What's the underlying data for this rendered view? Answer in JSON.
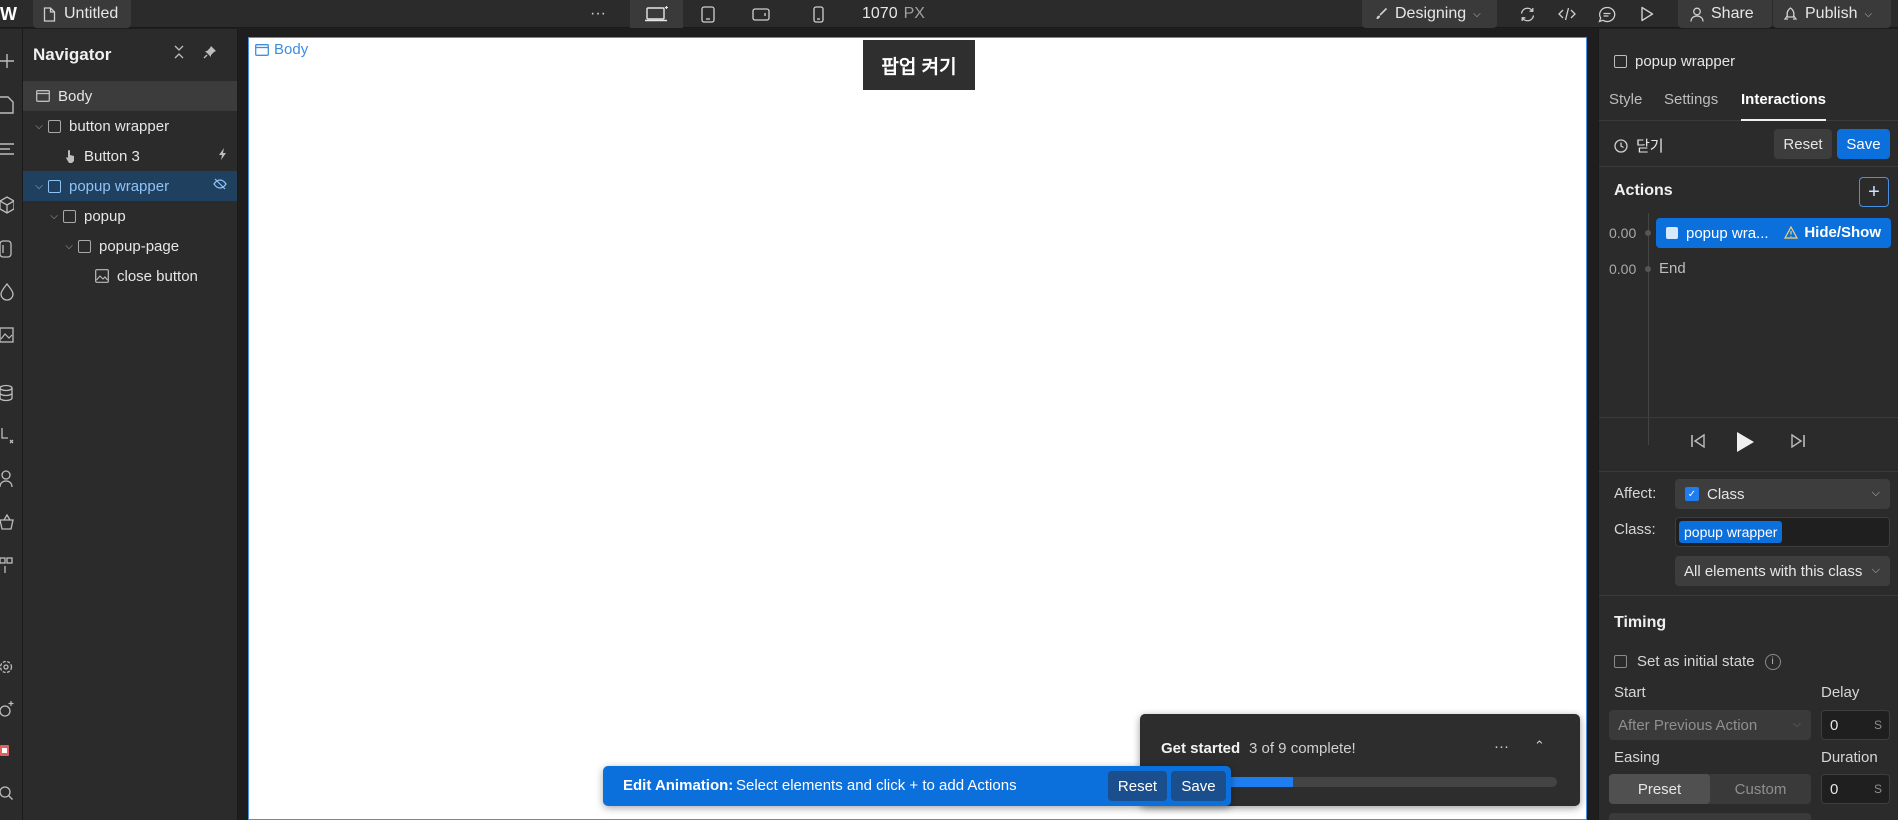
{
  "topbar": {
    "file_name": "Untitled",
    "more_label": "···",
    "width_value": "1070",
    "width_unit": "PX",
    "mode_label": "Designing",
    "share_label": "Share",
    "publish_label": "Publish"
  },
  "navigator": {
    "title": "Navigator",
    "items": [
      {
        "label": "Body"
      },
      {
        "label": "button wrapper"
      },
      {
        "label": "Button 3"
      },
      {
        "label": "popup wrapper"
      },
      {
        "label": "popup"
      },
      {
        "label": "popup-page"
      },
      {
        "label": "close button"
      }
    ]
  },
  "canvas": {
    "body_tag": "Body",
    "popup_button_text": "팝업 켜기"
  },
  "get_started": {
    "title": "Get started",
    "progress_text": "3 of 9 complete!",
    "progress_fraction": 0.333
  },
  "edit_animation": {
    "label": "Edit Animation:",
    "description": "Select elements and click + to add Actions",
    "reset_label": "Reset",
    "save_label": "Save"
  },
  "right_panel": {
    "element_name": "popup wrapper",
    "tabs": [
      "Style",
      "Settings",
      "Interactions"
    ],
    "active_tab": "Interactions",
    "trigger_name": "닫기",
    "reset_label": "Reset",
    "save_label": "Save",
    "actions_heading": "Actions",
    "actions": [
      {
        "time": "0.00",
        "target": "popup wra...",
        "type": "Hide/Show"
      },
      {
        "time": "0.00",
        "target": "End"
      }
    ],
    "affect_label": "Affect:",
    "affect_value": "Class",
    "class_label": "Class:",
    "class_value": "popup wrapper",
    "scope_value": "All elements with this class",
    "timing_heading": "Timing",
    "initial_state_label": "Set as initial state",
    "start_label": "Start",
    "start_value": "After Previous Action",
    "delay_label": "Delay",
    "delay_value": "0",
    "delay_unit": "S",
    "easing_label": "Easing",
    "easing_options": [
      "Preset",
      "Custom"
    ],
    "duration_label": "Duration",
    "duration_value": "0",
    "duration_unit": "S"
  },
  "colors": {
    "accent": "#0b6fdc",
    "selection_bg": "#20405f",
    "selection_text": "#8fc2f5",
    "canvas_outline": "#4a90e2"
  }
}
